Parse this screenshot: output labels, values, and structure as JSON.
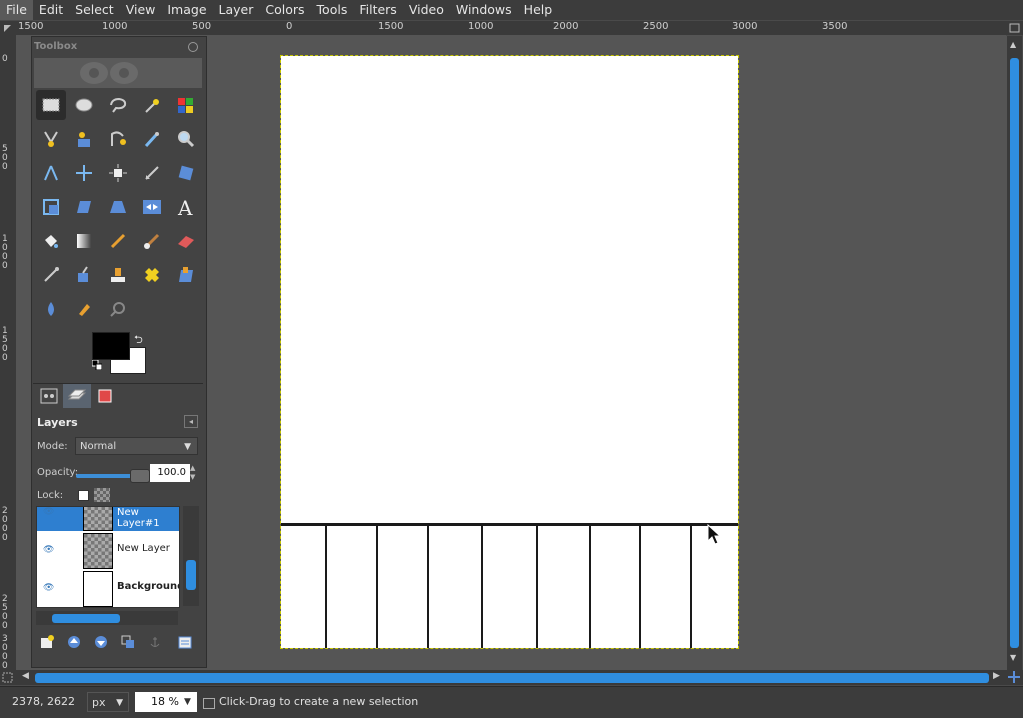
{
  "menubar": {
    "items": [
      "File",
      "Edit",
      "Select",
      "View",
      "Image",
      "Layer",
      "Colors",
      "Tools",
      "Filters",
      "Video",
      "Windows",
      "Help"
    ]
  },
  "ruler": {
    "h_labels": [
      "1500",
      "1000",
      "500",
      "0",
      "1500",
      "1000",
      "2000",
      "2500",
      "3000",
      "3500"
    ],
    "v_labels": [
      "0",
      "500",
      "1000",
      "1500",
      "2000",
      "2500",
      "3000"
    ]
  },
  "toolbox": {
    "title": "Toolbox",
    "tools": [
      [
        "rect-select-icon",
        "ellipse-select-icon",
        "free-select-icon",
        "fuzzy-select-icon",
        "select-by-color-icon"
      ],
      [
        "scissors-select-icon",
        "foreground-select-icon",
        "paths-icon",
        "color-picker-icon",
        "zoom-icon"
      ],
      [
        "measure-icon",
        "move-icon",
        "align-icon",
        "crop-icon",
        "rotate-icon"
      ],
      [
        "scale-icon",
        "shear-icon",
        "perspective-icon",
        "flip-icon",
        "text-icon"
      ],
      [
        "bucket-fill-icon",
        "blend-icon",
        "pencil-icon",
        "paintbrush-icon",
        "eraser-icon"
      ],
      [
        "airbrush-icon",
        "ink-icon",
        "clone-icon",
        "heal-icon",
        "perspective-clone-icon"
      ],
      [
        "blur-icon",
        "smudge-icon",
        "dodge-burn-icon"
      ]
    ],
    "fg_color": "#000000",
    "bg_color": "#ffffff"
  },
  "layers": {
    "title": "Layers",
    "mode_label": "Mode:",
    "mode_value": "Normal",
    "opacity_label": "Opacity:",
    "opacity_value": "100.0",
    "opacity_fraction": 1.0,
    "lock_label": "Lock:",
    "items": [
      {
        "name": "New Layer#1",
        "selected": true,
        "thumb": "transparent"
      },
      {
        "name": "New Layer",
        "selected": false,
        "thumb": "transparent"
      },
      {
        "name": "Background",
        "selected": false,
        "thumb": "white"
      }
    ]
  },
  "status": {
    "coords": "2378, 2622",
    "unit": "px",
    "zoom": "18 %",
    "hint": "Click-Drag to create a new selection"
  },
  "colors": {
    "accent": "#2f8ee0",
    "canvas_bg": "#555555",
    "ui_bg": "#434343",
    "selection_border": "#c8c800"
  }
}
